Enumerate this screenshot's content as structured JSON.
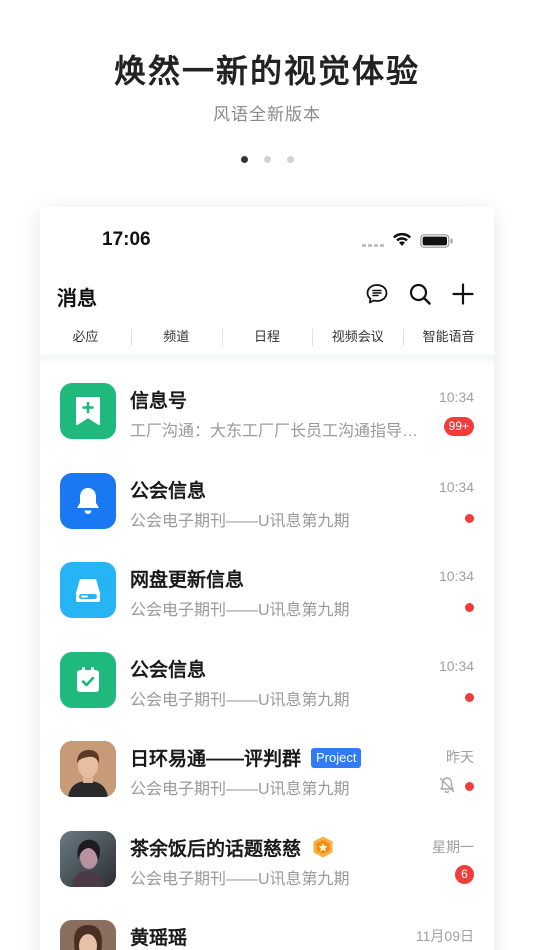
{
  "hero": {
    "title": "焕然一新的视觉体验",
    "subtitle": "风语全新版本",
    "pager_count": 3,
    "pager_active": 0
  },
  "status_bar": {
    "time": "17:06"
  },
  "header": {
    "title": "消息",
    "icons": [
      "chat-bubble-icon",
      "search-icon",
      "plus-icon"
    ]
  },
  "tabs": [
    "必应",
    "频道",
    "日程",
    "视频会议",
    "智能语音"
  ],
  "messages": [
    {
      "icon": "bookmark-plus-icon",
      "icon_bg": "#1fb97e",
      "title": "信息号",
      "preview": "工厂沟通：大东工厂厂长员工沟通指导工作",
      "time": "10:34",
      "badge": "99+"
    },
    {
      "icon": "bell-icon",
      "icon_bg": "#1b78f3",
      "title": "公会信息",
      "preview": "公会电子期刊——U讯息第九期",
      "time": "10:34",
      "dot": true
    },
    {
      "icon": "drive-icon",
      "icon_bg": "#27b4f4",
      "title": "网盘更新信息",
      "preview": "公会电子期刊——U讯息第九期",
      "time": "10:34",
      "dot": true
    },
    {
      "icon": "calendar-check-icon",
      "icon_bg": "#1fb97e",
      "title": "公会信息",
      "preview": "公会电子期刊——U讯息第九期",
      "time": "10:34",
      "dot": true
    },
    {
      "icon": "avatar-man",
      "title": "日环易通——评判群",
      "tag": "Project",
      "preview": "公会电子期刊——U讯息第九期",
      "time": "昨天",
      "dot": true,
      "muted": true
    },
    {
      "icon": "avatar-woman",
      "title": "茶余饭后的话题慈慈",
      "medal": true,
      "preview": "公会电子期刊——U讯息第九期",
      "time": "星期一",
      "badge": "6"
    },
    {
      "icon": "avatar-girl",
      "title": "黄瑶瑶",
      "preview": "",
      "time": "11月09日"
    }
  ],
  "colors": {
    "accent_green": "#1fb97e",
    "accent_blue": "#1b78f3",
    "accent_sky": "#27b4f4",
    "badge_red": "#f23b3b",
    "tag_blue": "#2f7cf6"
  }
}
